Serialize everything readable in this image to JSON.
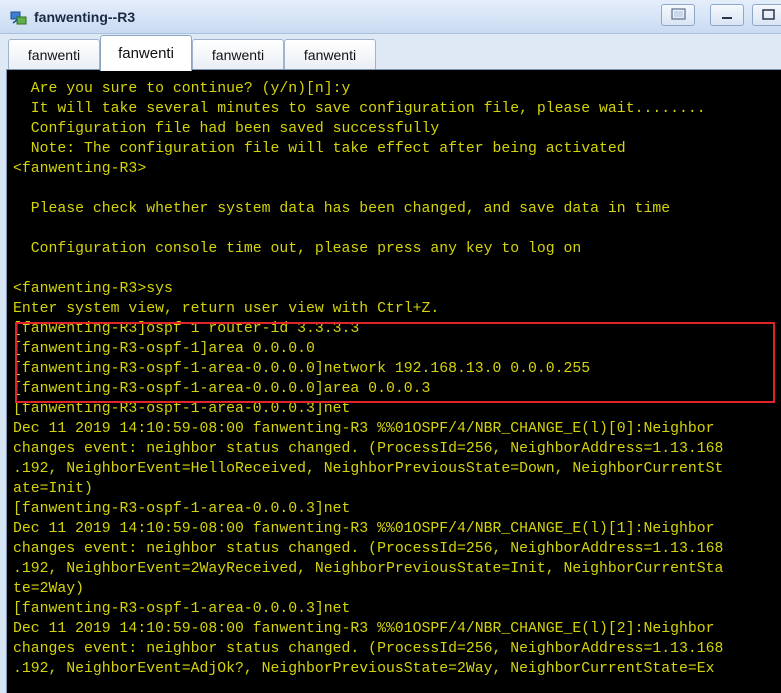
{
  "window": {
    "title": "fanwenting--R3"
  },
  "tabs": [
    {
      "label": "fanwenti",
      "active": false
    },
    {
      "label": "fanwenti",
      "active": true
    },
    {
      "label": "fanwenti",
      "active": false
    },
    {
      "label": "fanwenti",
      "active": false
    }
  ],
  "terminal": {
    "text_color": "#d4d40a",
    "background": "#000000",
    "lines": [
      "  Are you sure to continue? (y/n)[n]:y",
      "  It will take several minutes to save configuration file, please wait........",
      "  Configuration file had been saved successfully",
      "  Note: The configuration file will take effect after being activated",
      "<fanwenting-R3>",
      "",
      "  Please check whether system data has been changed, and save data in time",
      "",
      "  Configuration console time out, please press any key to log on",
      "",
      "<fanwenting-R3>sys",
      "Enter system view, return user view with Ctrl+Z.",
      "[fanwenting-R3]ospf 1 router-id 3.3.3.3",
      "[fanwenting-R3-ospf-1]area 0.0.0.0",
      "[fanwenting-R3-ospf-1-area-0.0.0.0]network 192.168.13.0 0.0.0.255",
      "[fanwenting-R3-ospf-1-area-0.0.0.0]area 0.0.0.3",
      "[fanwenting-R3-ospf-1-area-0.0.0.3]net",
      "Dec 11 2019 14:10:59-08:00 fanwenting-R3 %%01OSPF/4/NBR_CHANGE_E(l)[0]:Neighbor",
      "changes event: neighbor status changed. (ProcessId=256, NeighborAddress=1.13.168",
      ".192, NeighborEvent=HelloReceived, NeighborPreviousState=Down, NeighborCurrentSt",
      "ate=Init)",
      "[fanwenting-R3-ospf-1-area-0.0.0.3]net",
      "Dec 11 2019 14:10:59-08:00 fanwenting-R3 %%01OSPF/4/NBR_CHANGE_E(l)[1]:Neighbor",
      "changes event: neighbor status changed. (ProcessId=256, NeighborAddress=1.13.168",
      ".192, NeighborEvent=2WayReceived, NeighborPreviousState=Init, NeighborCurrentSta",
      "te=2Way)",
      "[fanwenting-R3-ospf-1-area-0.0.0.3]net",
      "Dec 11 2019 14:10:59-08:00 fanwenting-R3 %%01OSPF/4/NBR_CHANGE_E(l)[2]:Neighbor",
      "changes event: neighbor status changed. (ProcessId=256, NeighborAddress=1.13.168",
      ".192, NeighborEvent=AdjOk?, NeighborPreviousState=2Way, NeighborCurrentState=Ex"
    ]
  }
}
